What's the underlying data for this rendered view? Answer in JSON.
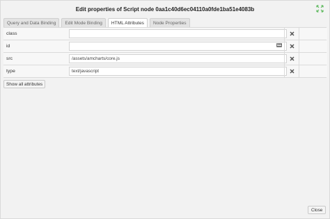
{
  "dialog": {
    "title": "Edit properties of Script node 0aa1c40d6ec04110a0fde1ba51e4083b",
    "accent_color": "#5cb85c"
  },
  "tabs": [
    {
      "label": "Query and Data Binding",
      "active": false
    },
    {
      "label": "Edit Mode Binding",
      "active": false
    },
    {
      "label": "HTML Attributes",
      "active": true
    },
    {
      "label": "Node Properties",
      "active": false
    }
  ],
  "attributes": [
    {
      "name": "class",
      "value": ""
    },
    {
      "name": "id",
      "value": ""
    },
    {
      "name": "src",
      "value": "/assets/amcharts/core.js"
    },
    {
      "name": "type",
      "value": "text/javascript"
    }
  ],
  "buttons": {
    "show_all": "Show all attributes",
    "close": "Close"
  },
  "icons": {
    "expand": "expand-arrows-icon",
    "delete": "delete-x-icon",
    "keyboard": "keyboard-icon"
  }
}
